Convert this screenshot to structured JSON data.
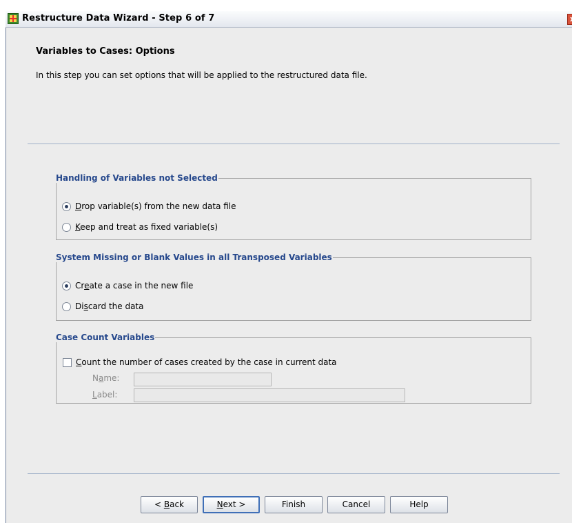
{
  "window": {
    "title": "Restructure Data Wizard - Step 6 of 7",
    "close_glyph": "x"
  },
  "page": {
    "heading": "Variables to Cases: Options",
    "description": "In this step you can set options that will be applied to the restructured data file."
  },
  "groups": {
    "unselected": {
      "legend": "Handling of Variables not Selected",
      "options": [
        {
          "mnemonic": "D",
          "rest": "rop variable(s) from the new data file",
          "selected": true
        },
        {
          "mnemonic": "K",
          "rest": "eep and treat as fixed variable(s)",
          "selected": false
        }
      ]
    },
    "missing": {
      "legend": "System Missing or Blank Values in all Transposed Variables",
      "options": [
        {
          "pre": "Cr",
          "mnemonic": "e",
          "rest": "ate a case in the new file",
          "selected": true
        },
        {
          "pre": "Di",
          "mnemonic": "s",
          "rest": "card the data",
          "selected": false
        }
      ]
    },
    "count": {
      "legend": "Case Count Variables",
      "checkbox": {
        "mnemonic": "C",
        "rest": "ount the number of cases created by the case in current data",
        "checked": false
      },
      "name_label": {
        "pre": "N",
        "mnemonic": "a",
        "rest": "me:"
      },
      "label_label": {
        "mnemonic": "L",
        "rest": "abel:"
      },
      "name_value": "",
      "label_value": ""
    }
  },
  "buttons": {
    "back": {
      "pre": "< ",
      "mnemonic": "B",
      "rest": "ack"
    },
    "next": {
      "mnemonic": "N",
      "rest": "ext >"
    },
    "finish": "Finish",
    "cancel": "Cancel",
    "help": "Help"
  },
  "colors": {
    "legend": "#26488c",
    "separator": "#9fb0c8",
    "dialog_bg": "#ececec"
  }
}
